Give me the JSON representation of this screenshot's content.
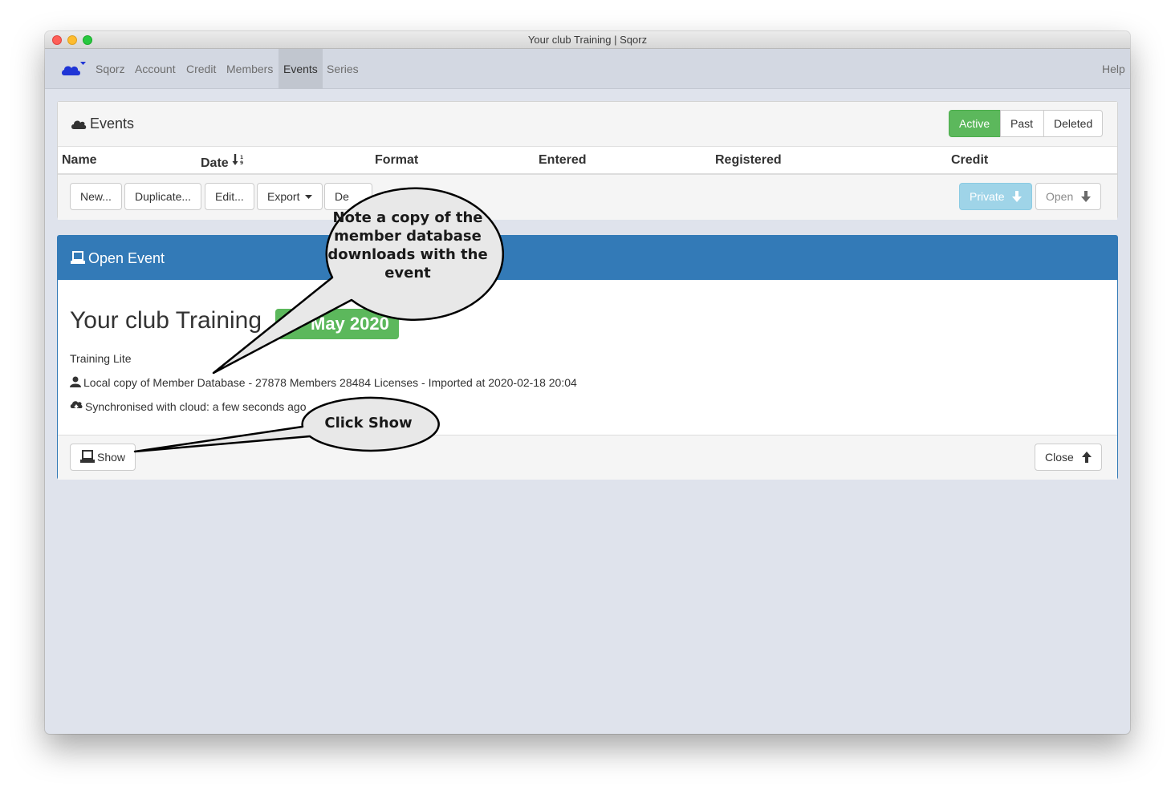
{
  "window": {
    "title": "Your club Training | Sqorz"
  },
  "nav": {
    "items": [
      "Sqorz",
      "Account",
      "Credit",
      "Members",
      "Events",
      "Series"
    ],
    "active": "Events",
    "help": "Help"
  },
  "events_panel": {
    "title": "Events",
    "filters": [
      "Active",
      "Past",
      "Deleted"
    ],
    "active_filter": "Active",
    "columns": [
      "Name",
      "Date",
      "Format",
      "Entered",
      "Registered",
      "Credit"
    ],
    "actions": {
      "new": "New...",
      "duplicate": "Duplicate...",
      "edit": "Edit...",
      "export": "Export",
      "delete_partial": "De"
    },
    "right_actions": {
      "private": "Private",
      "open": "Open"
    }
  },
  "open_event": {
    "header": "Open Event",
    "name": "Your club Training",
    "date_badge": "May 2020",
    "format": "Training Lite",
    "member_db": "Local copy of Member Database - 27878 Members 28484 Licenses - Imported at 2020-02-18 20:04",
    "sync": "Synchronised with cloud: a few seconds ago",
    "show_label": "Show",
    "close_label": "Close"
  },
  "callouts": {
    "note": [
      "Note a copy of the",
      "member database",
      "downloads with the",
      "event"
    ],
    "click": "Click Show"
  },
  "colors": {
    "success": "#5cb85c",
    "primary": "#337ab7",
    "info_disabled": "#9fd4e8",
    "brand": "#1f35d6"
  }
}
